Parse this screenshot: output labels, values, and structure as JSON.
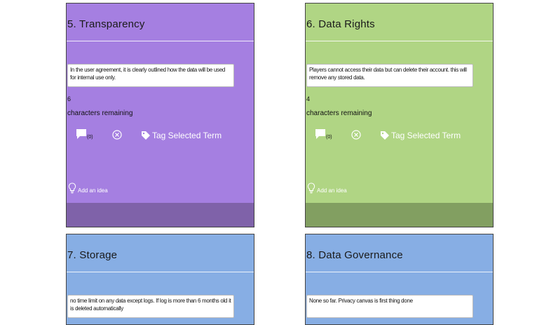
{
  "colors": {
    "purple": "#a57fe1",
    "purple_footer": "#7f62a9",
    "green": "#b0d584",
    "green_footer": "#829f61",
    "blue": "#87aee4"
  },
  "cards": [
    {
      "title": "5. Transparency",
      "text": "In the user agreement, it is clearly outlined how the data will be used for internal use only.",
      "count": "6",
      "count_label": "characters remaining",
      "comment_count": "(0)",
      "tag_label": "Tag Selected Term",
      "idea_label": "Add an idea"
    },
    {
      "title": "6. Data Rights",
      "text": "Players cannot access their data but can delete their account. this will remove any stored data.",
      "count": "4",
      "count_label": "characters remaining",
      "comment_count": "(0)",
      "tag_label": "Tag Selected Term",
      "idea_label": "Add an idea"
    },
    {
      "title": "7. Storage",
      "text": "no time limit on any data except logs. If log is more than 6 months old it is deleted automatically"
    },
    {
      "title": "8. Data Governance",
      "text": "None so far. Privacy canvas is first thing done"
    }
  ],
  "icons": {
    "comment": "comment-icon",
    "clear": "clear-circle-icon",
    "tag": "tag-icon",
    "idea": "lightbulb-icon"
  }
}
